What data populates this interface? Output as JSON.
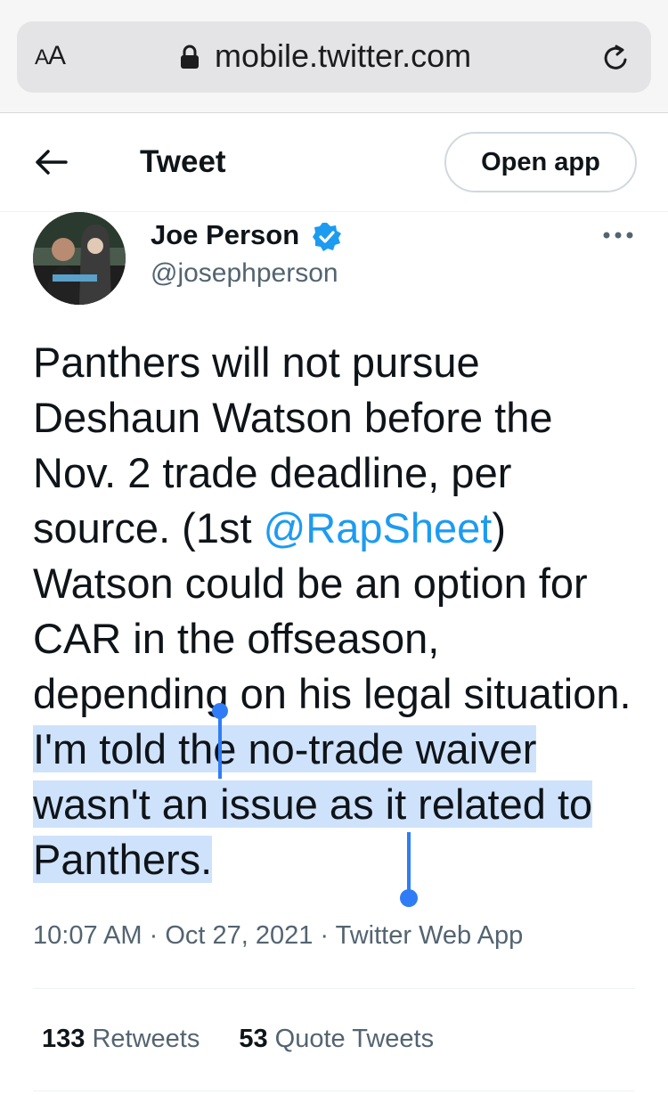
{
  "browser": {
    "aa_label_big": "A",
    "aa_label_small": "A",
    "url": "mobile.twitter.com"
  },
  "header": {
    "title": "Tweet",
    "open_app_label": "Open app"
  },
  "author": {
    "name": "Joe Person",
    "handle": "@josephperson",
    "verified": true
  },
  "tweet": {
    "text_part1": "Panthers will not pursue Deshaun Watson before the Nov. 2 trade deadline, per source. (1st ",
    "mention": "@RapSheet",
    "text_part2": ") Watson could be an option for CAR in the offseason, depending on his legal situation. ",
    "text_selected": "I'm told the no-trade waiver wasn't an issue as it related to Panthers.",
    "time": "10:07 AM",
    "date": "Oct 27, 2021",
    "source": "Twitter Web App",
    "meta_sep": " · "
  },
  "stats": {
    "retweets_count": "133",
    "retweets_label": "Retweets",
    "quotes_count": "53",
    "quotes_label": "Quote Tweets"
  },
  "colors": {
    "accent": "#1d9bf0",
    "selection": "#cfe2fb",
    "secondary_text": "#536471"
  }
}
